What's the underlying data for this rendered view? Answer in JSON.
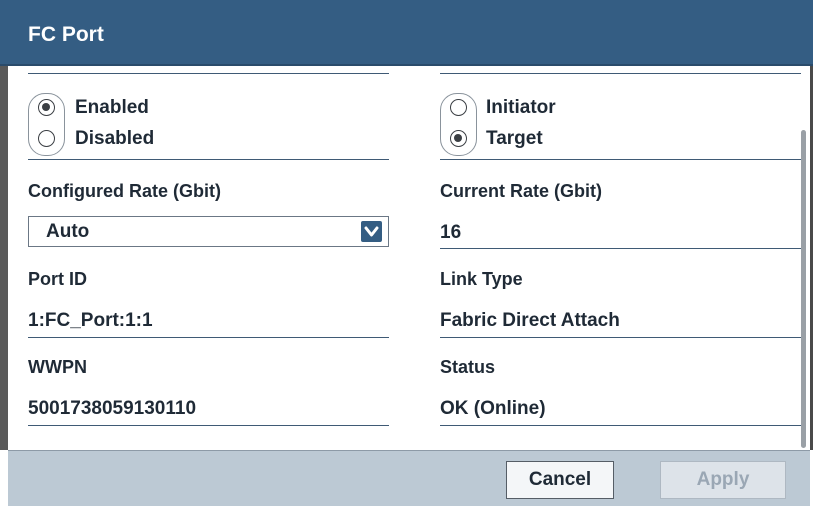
{
  "dialog": {
    "title": "FC Port"
  },
  "state_options": [
    "Enabled",
    "Disabled"
  ],
  "state_selected": "Enabled",
  "role_options": [
    "Initiator",
    "Target"
  ],
  "role_selected": "Target",
  "fields": {
    "configured_rate": {
      "label": "Configured Rate (Gbit)",
      "value": "Auto"
    },
    "current_rate": {
      "label": "Current Rate (Gbit)",
      "value": "16"
    },
    "port_id": {
      "label": "Port ID",
      "value": "1:FC_Port:1:1"
    },
    "link_type": {
      "label": "Link Type",
      "value": "Fabric Direct Attach"
    },
    "wwpn": {
      "label": "WWPN",
      "value": "5001738059130110"
    },
    "status": {
      "label": "Status",
      "value": "OK (Online)"
    }
  },
  "buttons": {
    "cancel": "Cancel",
    "apply": "Apply"
  },
  "colors": {
    "titlebar": "#345d83",
    "footer": "#bcc9d4",
    "text": "#1f2a36"
  },
  "icons": {
    "dropdown": "chevron-down-icon"
  }
}
